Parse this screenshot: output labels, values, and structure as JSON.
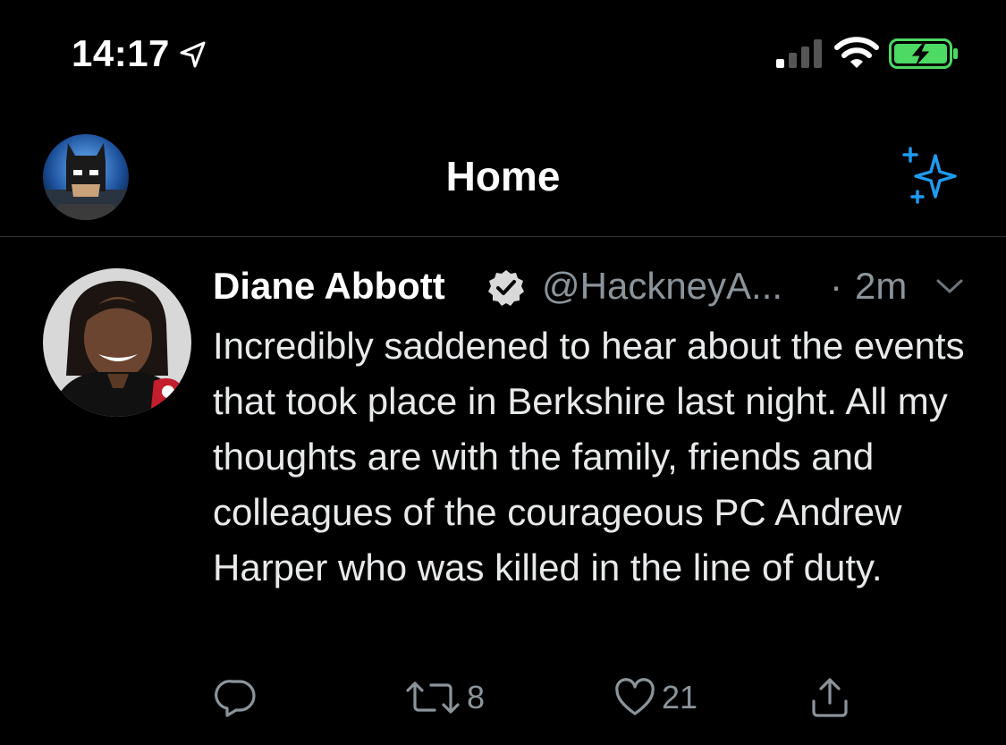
{
  "status_bar": {
    "time": "14:17",
    "icons": [
      "location-arrow-icon",
      "cellular-signal-icon",
      "wifi-icon",
      "battery-charging-icon"
    ],
    "battery_color": "#4cd964"
  },
  "header": {
    "title": "Home",
    "avatar": "profile-avatar",
    "right_icon": "sparkle-icon",
    "accent_color": "#1d9bf0"
  },
  "tweet": {
    "display_name": "Diane Abbott",
    "verified": true,
    "handle": "@HackneyA...",
    "separator": "·",
    "time_ago": "2m",
    "text": "Incredibly saddened to hear about the events that took place in Berkshire last night. All my thoughts are with the family, friends and colleagues of the courageous PC Andrew Harper who was killed in the line of duty.",
    "actions": {
      "reply_count": "",
      "retweet_count": "8",
      "like_count": "21"
    }
  },
  "colors": {
    "background": "#000000",
    "text": "#ffffff",
    "secondary_text": "#8b949b",
    "divider": "#2f3336"
  }
}
